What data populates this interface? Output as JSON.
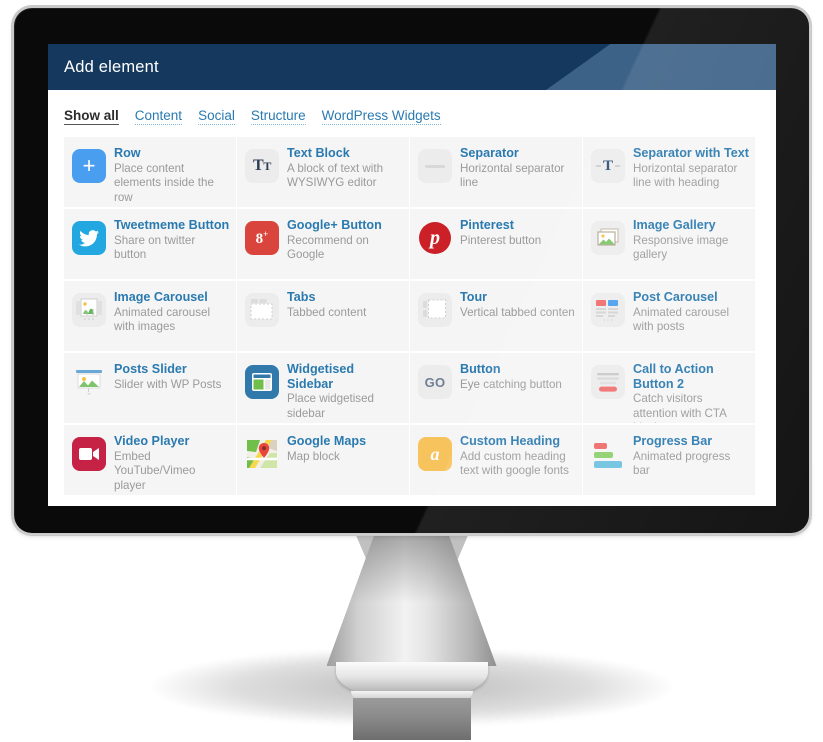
{
  "window": {
    "title": "Add element",
    "header_bg": "#15395e",
    "header_highlight": "#3d6287",
    "accent": "#2a7ab0"
  },
  "tabs": [
    {
      "label": "Show all",
      "active": true
    },
    {
      "label": "Content",
      "active": false
    },
    {
      "label": "Social",
      "active": false
    },
    {
      "label": "Structure",
      "active": false
    },
    {
      "label": "WordPress Widgets",
      "active": false
    }
  ],
  "elements": [
    {
      "name": "Row",
      "desc": "Place content elements inside the row",
      "icon": "plus-square-icon"
    },
    {
      "name": "Text Block",
      "desc": "A block of text with WYSIWYG editor",
      "icon": "text-tt-icon"
    },
    {
      "name": "Separator",
      "desc": "Horizontal separator line",
      "icon": "separator-line-icon"
    },
    {
      "name": "Separator with Text",
      "desc": "Horizontal separator line with heading",
      "icon": "separator-text-icon"
    },
    {
      "name": "Tweetmeme Button",
      "desc": "Share on twitter button",
      "icon": "twitter-icon"
    },
    {
      "name": "Google+ Button",
      "desc": "Recommend on Google",
      "icon": "google-plus-icon"
    },
    {
      "name": "Pinterest",
      "desc": "Pinterest button",
      "icon": "pinterest-icon"
    },
    {
      "name": "Image Gallery",
      "desc": "Responsive image gallery",
      "icon": "image-gallery-icon"
    },
    {
      "name": "Image Carousel",
      "desc": "Animated carousel with images",
      "icon": "image-carousel-icon"
    },
    {
      "name": "Tabs",
      "desc": "Tabbed content",
      "icon": "tabs-icon"
    },
    {
      "name": "Tour",
      "desc": "Vertical tabbed conten",
      "icon": "tour-icon"
    },
    {
      "name": "Post Carousel",
      "desc": "Animated carousel with posts",
      "icon": "post-carousel-icon"
    },
    {
      "name": "Posts Slider",
      "desc": "Slider with WP Posts",
      "icon": "posts-slider-icon"
    },
    {
      "name": "Widgetised Sidebar",
      "desc": "Place widgetised sidebar",
      "icon": "widgetised-sidebar-icon"
    },
    {
      "name": "Button",
      "desc": "Eye catching button",
      "icon": "go-button-icon"
    },
    {
      "name": "Call to Action Button 2",
      "desc": "Catch visitors attention with CTA block",
      "icon": "cta-block-icon"
    },
    {
      "name": "Video Player",
      "desc": "Embed YouTube/Vimeo player",
      "icon": "video-player-icon"
    },
    {
      "name": "Google Maps",
      "desc": "Map block",
      "icon": "google-maps-icon"
    },
    {
      "name": "Custom Heading",
      "desc": "Add custom heading text with google fonts",
      "icon": "custom-heading-icon"
    },
    {
      "name": "Progress Bar",
      "desc": "Animated progress bar",
      "icon": "progress-bar-icon"
    }
  ]
}
